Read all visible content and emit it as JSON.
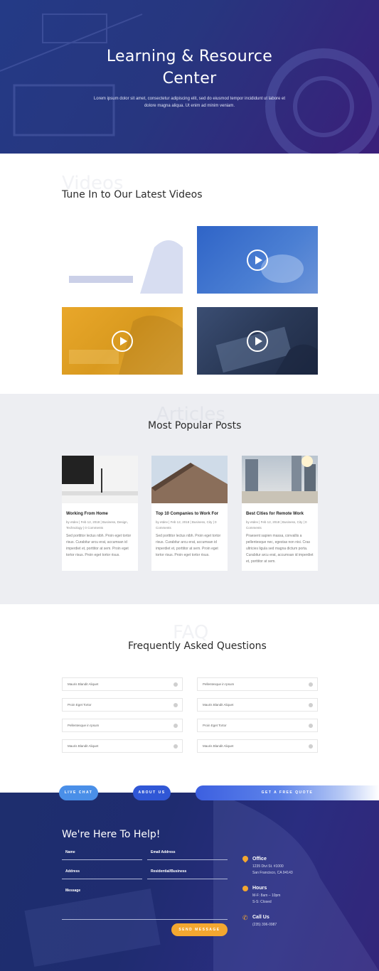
{
  "hero": {
    "title_line1": "Learning & Resource",
    "title_line2": "Center",
    "subtitle": "Lorem ipsum dolor sit amet, consectetur adipiscing elit, sed do eiusmod tempor incididunt ut labore et dolore magna aliqua. Ut enim ad minim veniam."
  },
  "videos": {
    "ghost": "Videos",
    "title": "Tune In to Our Latest Videos"
  },
  "articles": {
    "ghost": "Articles",
    "title": "Most Popular Posts",
    "posts": [
      {
        "title": "Working From Home",
        "meta": "by etdev | Feb 12, 2018 | Business, Design, Technology | 0 Comments",
        "excerpt": "Sed porttitor lectus nibh. Proin eget tortor risus. Curabitur arcu erat, accumsan id imperdiet et, porttitor at sem. Proin eget tortor risus. Proin eget tortor risus."
      },
      {
        "title": "Top 10 Companies to Work For",
        "meta": "by etdev | Feb 12, 2018 | Business, City | 0 Comments",
        "excerpt": "Sed porttitor lectus nibh. Proin eget tortor risus. Curabitur arcu erat, accumsan id imperdiet et, porttitor at sem. Proin eget tortor risus. Proin eget tortor risus."
      },
      {
        "title": "Best Cities for Remote Work",
        "meta": "by etdev | Feb 12, 2018 | Business, City | 0 Comments",
        "excerpt": "Praesent sapien massa, convallis a pellentesque nec, egestas non nisi. Cras ultricies ligula sed magna dictum porta. Curabitur arcu erat, accumsan id imperdiet et, porttitor at sem."
      }
    ]
  },
  "faq": {
    "ghost": "FAQ",
    "title": "Frequently Asked Questions",
    "left": [
      "Mauris Blandit Aliquet",
      "Proin Eget Tortor",
      "Pellentesque in Ipsum",
      "Mauris Blandit Aliquet"
    ],
    "right": [
      "Pellentesque in Ipsum",
      "Mauris Blandit Aliquet",
      "Proin Eget Tortor",
      "Mauris Blandit Aliquet"
    ]
  },
  "cta": {
    "live_chat": "LIVE CHAT",
    "about_us": "ABOUT US",
    "quote": "GET A FREE QUOTE"
  },
  "contact": {
    "title": "We're Here To Help!",
    "name": "Name",
    "email": "Email Address",
    "address": "Address",
    "residential": "Residential/Business",
    "message": "Message",
    "send": "SEND MESSAGE",
    "office_title": "Office",
    "office_line1": "1235 Divi St. #1000",
    "office_line2": "San Francisco, CA 94143",
    "hours_title": "Hours",
    "hours_line1": "M-F: 8am – 10pm",
    "hours_line2": "S-S: Closed",
    "call_title": "Call Us",
    "call_line1": "(235) 396-0987"
  },
  "colors": {
    "accent": "#f3a730",
    "brand": "#2a3a8a",
    "blue": "#3e7ee6"
  }
}
